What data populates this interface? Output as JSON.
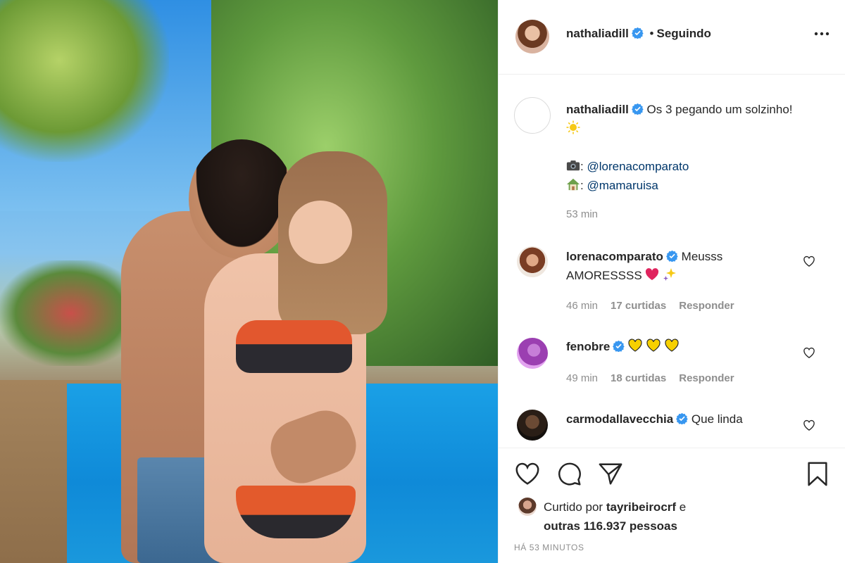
{
  "post": {
    "author": "nathaliadill",
    "follow_separator": "•",
    "follow_status": "Seguindo",
    "more_label": "•••"
  },
  "caption": {
    "username": "nathaliadill",
    "line1": "Os 3 pegando um solzinho!",
    "photo_prefix": ":",
    "photo_credit": "@lorenacomparato",
    "house_prefix": ":",
    "house_credit": "@mamaruisa",
    "time": "53 min"
  },
  "comments": [
    {
      "username": "lorenacomparato",
      "verified": true,
      "text": "Meusss AMORESSSS",
      "time": "46 min",
      "likes": "17 curtidas",
      "reply": "Responder"
    },
    {
      "username": "fenobre",
      "verified": true,
      "text": "",
      "time": "49 min",
      "likes": "18 curtidas",
      "reply": "Responder"
    },
    {
      "username": "carmodallavecchia",
      "verified": true,
      "text": "Que linda"
    }
  ],
  "likes": {
    "prefix": "Curtido por",
    "user": "tayribeirocrf",
    "conj": "e",
    "others": "outras 116.937 pessoas"
  },
  "timestamp": "HÁ 53 MINUTOS",
  "colors": {
    "verified_blue": "#3897f0",
    "link": "#00376b",
    "muted": "#8e8e8e",
    "heart_red": "#e0245e",
    "heart_yellow": "#f7d000"
  },
  "icons": [
    "more-icon",
    "heart-icon",
    "comment-icon",
    "share-icon",
    "bookmark-icon",
    "verified-icon",
    "camera-icon",
    "house-icon",
    "sun-icon",
    "sparkle-icon"
  ]
}
